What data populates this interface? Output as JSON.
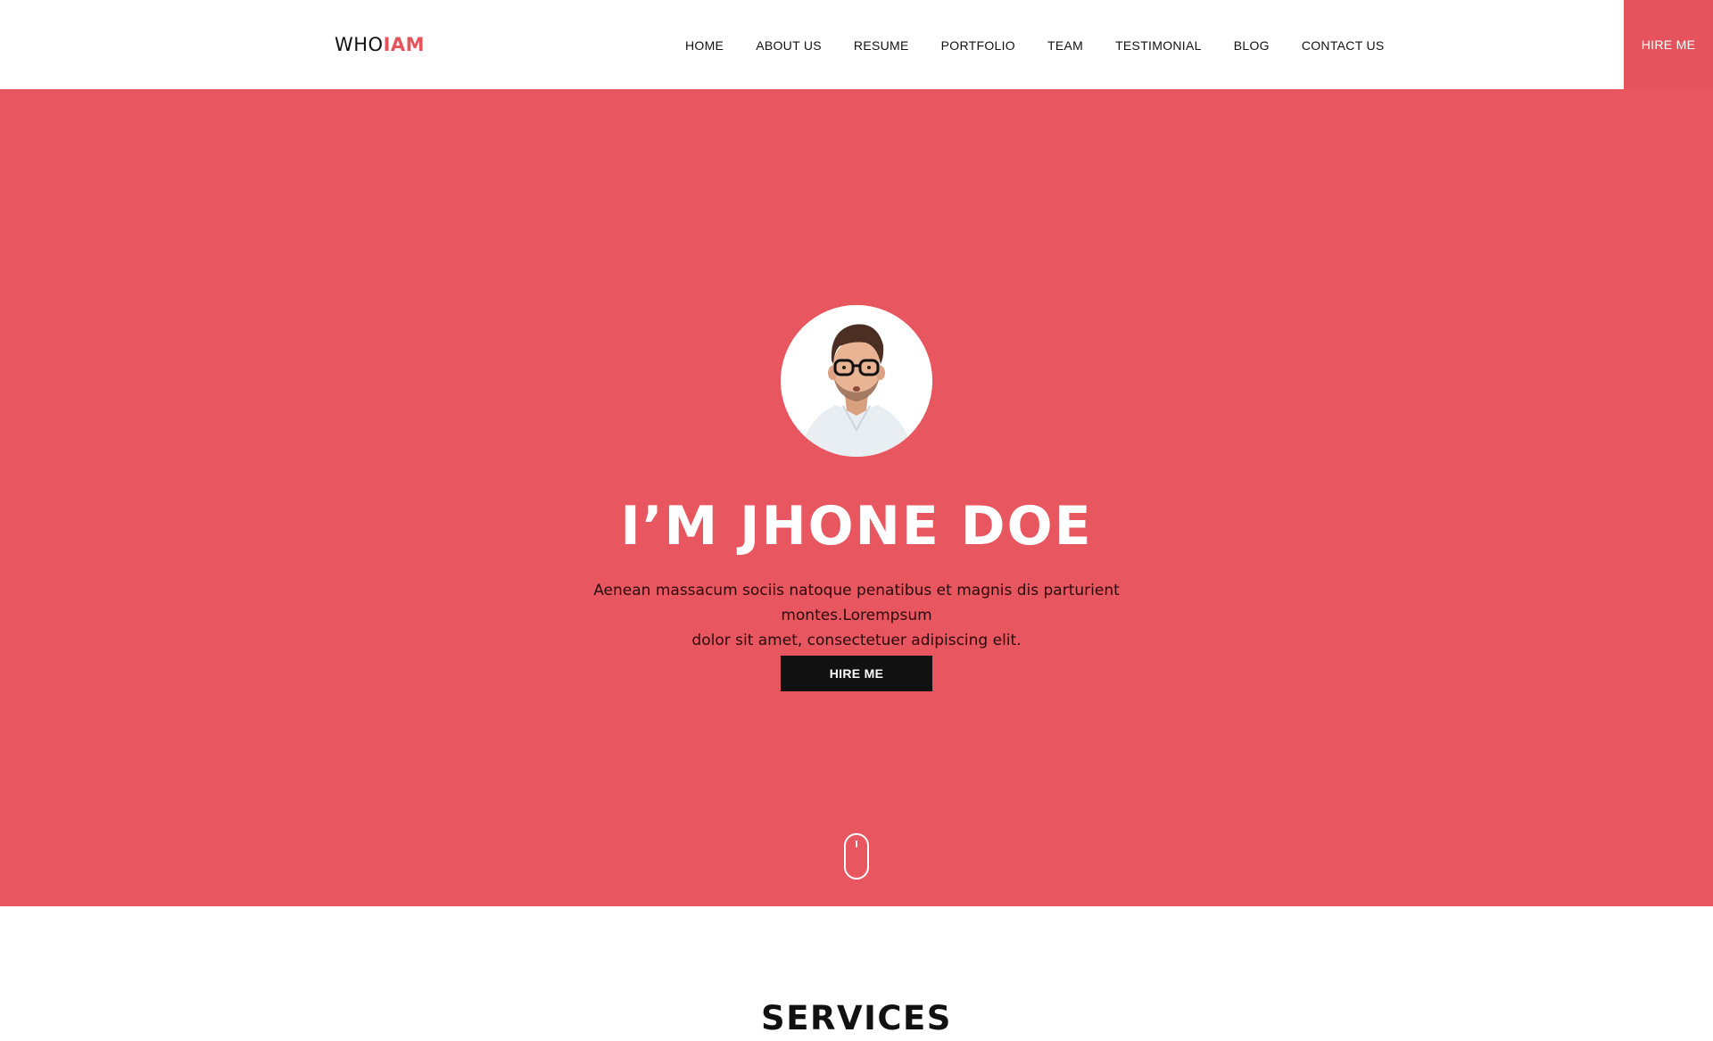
{
  "header": {
    "logo_part1": "WHO",
    "logo_part2": "IAM",
    "nav": [
      "HOME",
      "ABOUT US",
      "RESUME",
      "PORTFOLIO",
      "TEAM",
      "TESTIMONIAL",
      "BLOG",
      "CONTACT US"
    ],
    "hire_label": "HIRE ME"
  },
  "hero": {
    "title": "I’M JHONE DOE",
    "description_line1": "Aenean massacum sociis natoque penatibus et magnis dis parturient montes.Lorempsum",
    "description_line2": "dolor sit amet, consectetuer adipiscing elit.",
    "button_label": "HIRE ME",
    "scroll_icon": "mouse-scroll-icon"
  },
  "services": {
    "title": "SERVICES"
  },
  "colors": {
    "accent": "#e5545c",
    "hero_bg": "#e85760",
    "button_dark": "#111111"
  }
}
